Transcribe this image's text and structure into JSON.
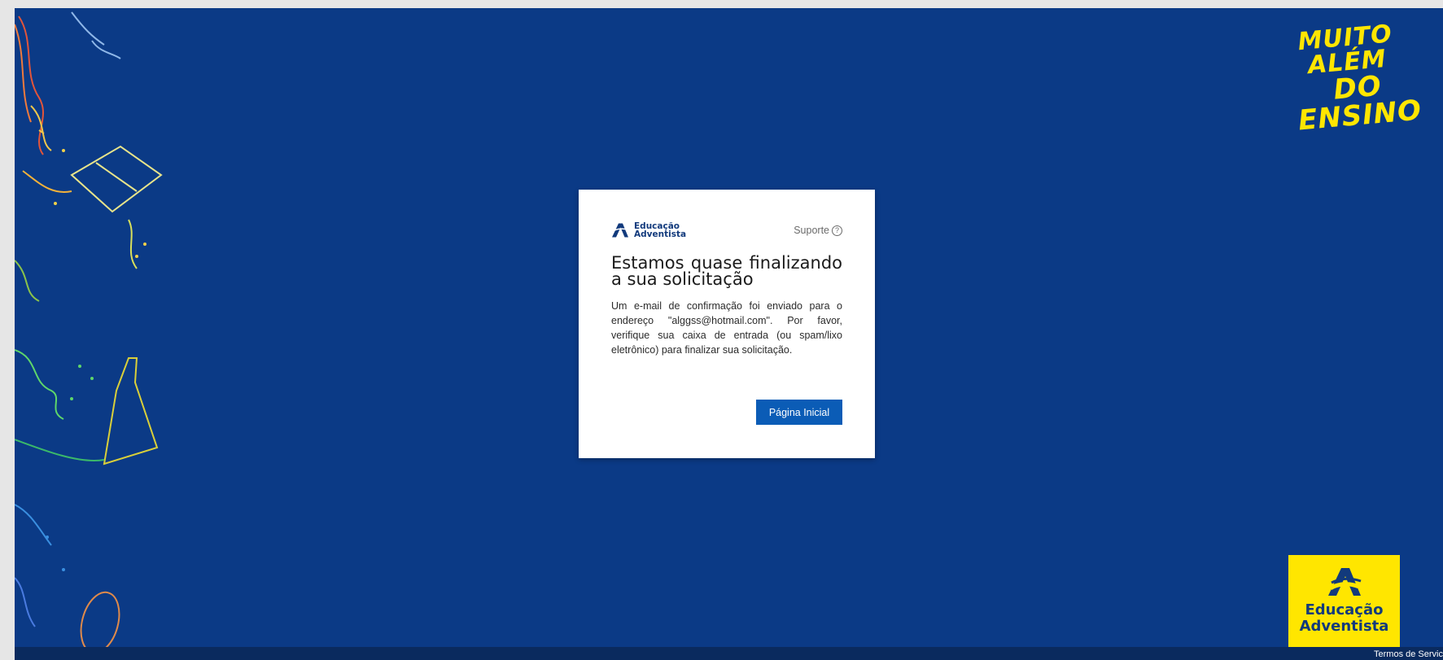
{
  "brand": {
    "logo_text_line1": "Educação",
    "logo_text_line2": "Adventista",
    "tagline_line1": "MUITO ALÉM",
    "tagline_line2": "DO ENSINO"
  },
  "dialog": {
    "support_label": "Suporte",
    "support_icon": "question-circle-icon",
    "title": "Estamos quase finalizando a sua solicitação",
    "message": "Um e-mail de confirmação foi enviado para o endereço \"alggss@hotmail.com\". Por favor, verifique sua caixa de entrada (ou spam/lixo eletrônico) para finalizar sua solicitação.",
    "primary_button": "Página Inicial"
  },
  "footer": {
    "terms_link": "Termos de Servic"
  },
  "colors": {
    "background": "#0b3a86",
    "accent_yellow": "#ffe600",
    "button_blue": "#0b5cb6",
    "brand_navy": "#123a7c"
  }
}
